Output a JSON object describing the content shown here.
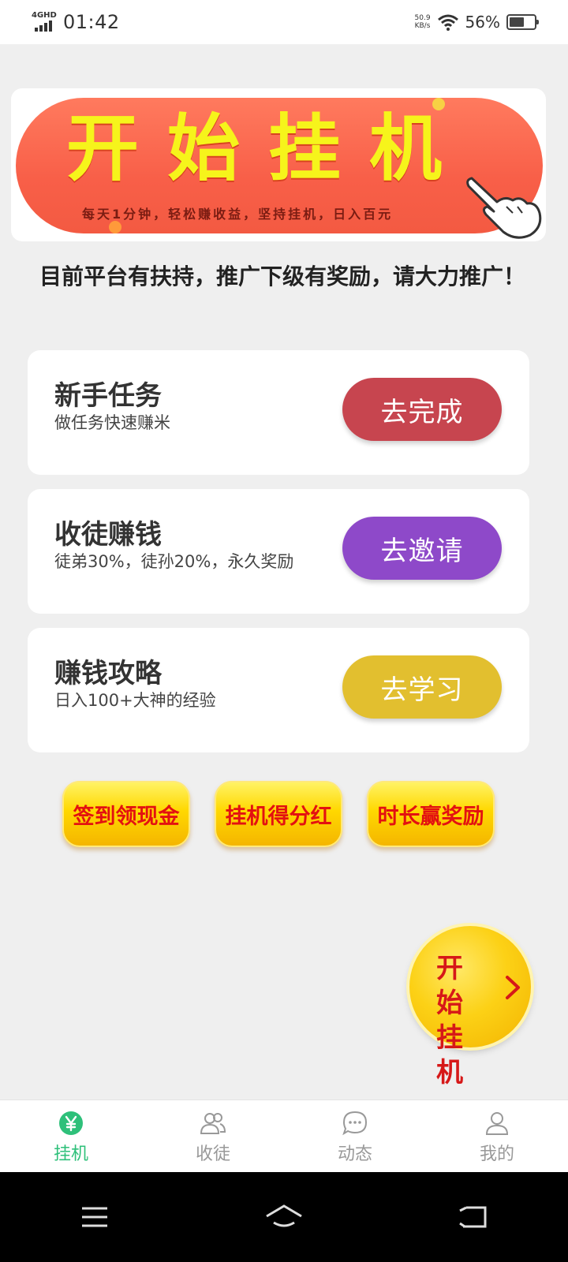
{
  "status_bar": {
    "network": "4GHD",
    "time": "01:42",
    "speed_value": "50.9",
    "speed_unit": "KB/s",
    "battery": "56%"
  },
  "banner": {
    "title": "开始挂机",
    "subtitle": "每天1分钟，轻松赚收益，坚持挂机，日入百元"
  },
  "notice": "目前平台有扶持，推广下级有奖励，请大力推广！",
  "tasks": [
    {
      "title": "新手任务",
      "desc": "做任务快速赚米",
      "button": "去完成",
      "color": "#c7454f"
    },
    {
      "title": "收徒赚钱",
      "desc": "徒弟30%，徒孙20%，永久奖励",
      "button": "去邀请",
      "color": "#8e49c9"
    },
    {
      "title": "赚钱攻略",
      "desc": "日入100+大神的经验",
      "button": "去学习",
      "color": "#e2bf2f"
    }
  ],
  "promos": [
    "签到领现金",
    "挂机得分红",
    "时长赢奖励"
  ],
  "fab": {
    "line1": "开始",
    "line2": "挂机"
  },
  "tabbar": {
    "active_color": "#2ec07a",
    "items": [
      {
        "label": "挂机",
        "icon": "yen-icon"
      },
      {
        "label": "收徒",
        "icon": "users-icon"
      },
      {
        "label": "动态",
        "icon": "chat-icon"
      },
      {
        "label": "我的",
        "icon": "user-icon"
      }
    ]
  }
}
